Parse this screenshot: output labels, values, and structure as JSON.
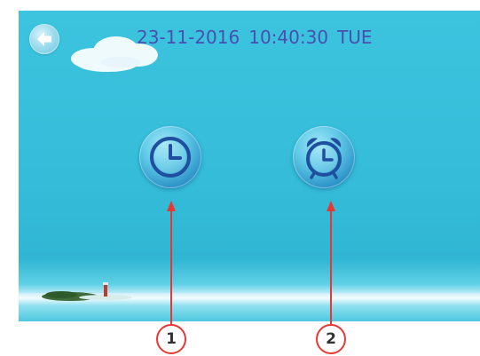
{
  "header": {
    "date": "23-11-2016",
    "time": "10:40:30",
    "weekday": "TUE"
  },
  "icons": {
    "back": "back-arrow-icon",
    "time": "clock-icon",
    "alarm": "alarm-clock-icon"
  },
  "annotations": {
    "marker_1": "1",
    "marker_2": "2"
  },
  "colors": {
    "screen_background": "#34bcd8",
    "datetime_text": "#4a4faf",
    "annotation": "#e53935"
  }
}
